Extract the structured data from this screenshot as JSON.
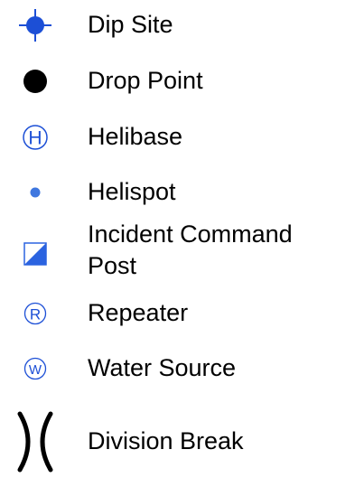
{
  "legend": {
    "items": [
      {
        "label": "Dip Site",
        "icon": "dip-site-icon"
      },
      {
        "label": "Drop Point",
        "icon": "drop-point-icon"
      },
      {
        "label": "Helibase",
        "icon": "helibase-icon",
        "glyph": "H"
      },
      {
        "label": "Helispot",
        "icon": "helispot-icon"
      },
      {
        "label_line1": "Incident Command",
        "label_line2": "Post",
        "icon": "incident-command-post-icon"
      },
      {
        "label": "Repeater",
        "icon": "repeater-icon",
        "glyph": "R"
      },
      {
        "label": "Water Source",
        "icon": "water-source-icon",
        "glyph": "W"
      },
      {
        "label": "Division Break",
        "icon": "division-break-icon"
      }
    ]
  },
  "colors": {
    "symbol_blue": "#1c4fd6",
    "helispot_blue": "#3f77df",
    "icp_blue": "#2b63e0",
    "black": "#000000"
  }
}
